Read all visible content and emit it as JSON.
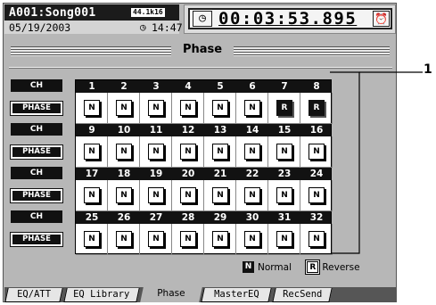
{
  "header": {
    "song": "A001:Song001",
    "sample_rate_badge": "44.1k16",
    "date": "05/19/2003",
    "clock_icon": "clock-icon",
    "clock_time": "14:47",
    "timer_icon": "stopwatch-icon",
    "timer_icon_glyph": "◷",
    "time": "00:03:53.895",
    "alarm_icon": "alarm-clock-icon",
    "alarm_icon_glyph": "⏰"
  },
  "page": {
    "title": "Phase"
  },
  "labels": {
    "ch": "CH",
    "phase": "PHASE"
  },
  "channels": [
    {
      "ch": "1",
      "phase": "N"
    },
    {
      "ch": "2",
      "phase": "N"
    },
    {
      "ch": "3",
      "phase": "N"
    },
    {
      "ch": "4",
      "phase": "N"
    },
    {
      "ch": "5",
      "phase": "N"
    },
    {
      "ch": "6",
      "phase": "N"
    },
    {
      "ch": "7",
      "phase": "R"
    },
    {
      "ch": "8",
      "phase": "R"
    },
    {
      "ch": "9",
      "phase": "N"
    },
    {
      "ch": "10",
      "phase": "N"
    },
    {
      "ch": "11",
      "phase": "N"
    },
    {
      "ch": "12",
      "phase": "N"
    },
    {
      "ch": "13",
      "phase": "N"
    },
    {
      "ch": "14",
      "phase": "N"
    },
    {
      "ch": "15",
      "phase": "N"
    },
    {
      "ch": "16",
      "phase": "N"
    },
    {
      "ch": "17",
      "phase": "N"
    },
    {
      "ch": "18",
      "phase": "N"
    },
    {
      "ch": "19",
      "phase": "N"
    },
    {
      "ch": "20",
      "phase": "N"
    },
    {
      "ch": "21",
      "phase": "N"
    },
    {
      "ch": "22",
      "phase": "N"
    },
    {
      "ch": "23",
      "phase": "N"
    },
    {
      "ch": "24",
      "phase": "N"
    },
    {
      "ch": "25",
      "phase": "N"
    },
    {
      "ch": "26",
      "phase": "N"
    },
    {
      "ch": "27",
      "phase": "N"
    },
    {
      "ch": "28",
      "phase": "N"
    },
    {
      "ch": "29",
      "phase": "N"
    },
    {
      "ch": "30",
      "phase": "N"
    },
    {
      "ch": "31",
      "phase": "N"
    },
    {
      "ch": "32",
      "phase": "N"
    }
  ],
  "legend": {
    "normal_symbol": "N",
    "normal_label": "Normal",
    "reverse_symbol": "R",
    "reverse_label": "Reverse"
  },
  "tabs": [
    {
      "label": "EQ/ATT",
      "active": false
    },
    {
      "label": "EQ Library",
      "active": false
    },
    {
      "label": "Phase",
      "active": true
    },
    {
      "label": "MasterEQ",
      "active": false
    },
    {
      "label": "RecSend",
      "active": false
    }
  ],
  "callout": {
    "number": "1"
  }
}
